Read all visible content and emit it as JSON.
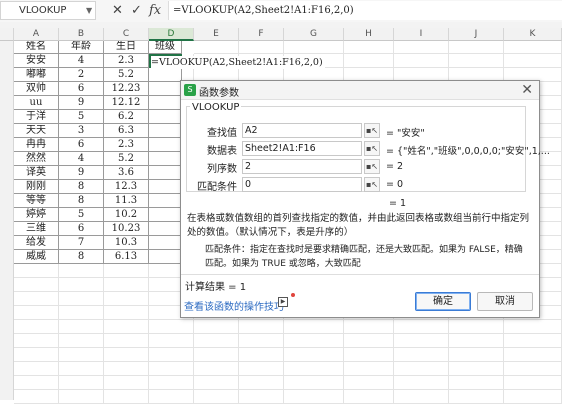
{
  "formula_bar": {
    "name_box": "VLOOKUP",
    "cancel_icon": "✕",
    "confirm_icon": "✓",
    "fx_label": "fx",
    "formula": "=VLOOKUP(A2,Sheet2!A1:F16,2,0)"
  },
  "columns": [
    "A",
    "B",
    "C",
    "D",
    "E",
    "F",
    "G",
    "H",
    "I",
    "J",
    "K"
  ],
  "table": {
    "headers": [
      "姓名",
      "年龄",
      "生日",
      "班级"
    ],
    "rows": [
      [
        "安安",
        "4",
        "2.3"
      ],
      [
        "嘟嘟",
        "2",
        "5.2"
      ],
      [
        "双帅",
        "6",
        "12.23"
      ],
      [
        "uu",
        "9",
        "12.12"
      ],
      [
        "于洋",
        "5",
        "6.2"
      ],
      [
        "天天",
        "3",
        "6.3"
      ],
      [
        "冉冉",
        "6",
        "2.3"
      ],
      [
        "然然",
        "4",
        "5.2"
      ],
      [
        "译英",
        "9",
        "3.6"
      ],
      [
        "刚刚",
        "8",
        "12.3"
      ],
      [
        "等等",
        "8",
        "11.3"
      ],
      [
        "婷婷",
        "5",
        "10.2"
      ],
      [
        "三维",
        "6",
        "10.23"
      ],
      [
        "给发",
        "7",
        "10.3"
      ],
      [
        "威威",
        "8",
        "6.13"
      ]
    ]
  },
  "dialog": {
    "title": "函数参数",
    "close_icon": "✕",
    "function_name": "VLOOKUP",
    "args": [
      {
        "label": "查找值",
        "value": "A2",
        "result": "= \"安安\""
      },
      {
        "label": "数据表",
        "value": "Sheet2!A1:F16",
        "result": "= {\"姓名\",\"班级\",0,0,0,0;\"安安\",1,..."
      },
      {
        "label": "列序数",
        "value": "2",
        "result": "= 2"
      },
      {
        "label": "匹配条件",
        "value": "0",
        "result": "= 0"
      }
    ],
    "total_result": "= 1",
    "description": "在表格或数值数组的首列查找指定的数值，并由此返回表格或数组当前行中指定列处的数值。（默认情况下，表是升序的）",
    "param_description": "匹配条件：指定在查找时是要求精确匹配，还是大致匹配。如果为 FALSE，精确匹配。如果为 TRUE 或忽略，大致匹配",
    "calc_result": "计算结果 = 1",
    "tip_link": "查看该函数的操作技巧",
    "ok_label": "确定",
    "cancel_label": "取消"
  }
}
